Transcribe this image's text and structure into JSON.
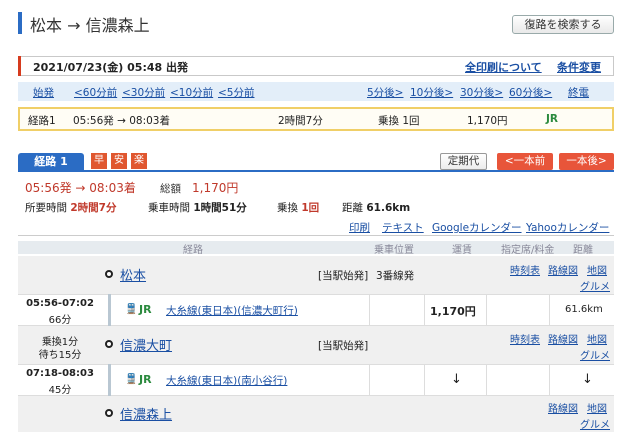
{
  "header": {
    "title": "松本 → 信濃森上",
    "search_button": "復路を検索する"
  },
  "date_bar": {
    "text": "2021/07/23(金) 05:48 出発",
    "print_all": "全印刷について",
    "change_cond": "条件変更"
  },
  "time_nav": {
    "first": "始発",
    "b60": "<60分前",
    "b30": "<30分前",
    "b10": "<10分前",
    "b5": "<5分前",
    "a5": "5分後>",
    "a10": "10分後>",
    "a30": "30分後>",
    "a60": "60分後>",
    "last": "終電"
  },
  "summary": {
    "route": "経路1",
    "times": "05:56発 → 08:03着",
    "duration": "2時間7分",
    "transfer": "乗換 1回",
    "fare": "1,170円",
    "operator": "JR"
  },
  "tabs": {
    "route": "経路 1",
    "badges": [
      "早",
      "安",
      "楽"
    ],
    "teiki": "定期代",
    "prev": "<一本前",
    "next": "一本後>"
  },
  "detail": {
    "time": "05:56発 → 08:03着",
    "total_label": "総額",
    "total_value": "1,170円",
    "req_label": "所要時間",
    "req_value": "2時間7分",
    "ride_label": "乗車時間",
    "ride_value": "1時間51分",
    "transfer_label": "乗換",
    "transfer_value": "1回",
    "distance_label": "距離",
    "distance_value": "61.6km",
    "tools": [
      "印刷",
      "テキスト",
      "Googleカレンダー",
      "Yahooカレンダー"
    ]
  },
  "table": {
    "headers": [
      "経路",
      "乗車位置",
      "運賃",
      "指定席/料金",
      "距離"
    ],
    "stations": [
      {
        "name": "松本",
        "note": "[当駅始発]",
        "platform": "3番線発",
        "links": [
          "時刻表",
          "路線図",
          "地図",
          "グルメ"
        ]
      },
      {
        "name": "信濃大町",
        "note": "[当駅始発]",
        "links": [
          "時刻表",
          "路線図",
          "地図",
          "グルメ"
        ]
      },
      {
        "name": "信濃森上",
        "links": [
          "路線図",
          "地図",
          "グルメ"
        ]
      }
    ],
    "legs": [
      {
        "time": "05:56-07:02",
        "duration": "66分",
        "icon": "train-icon",
        "company": "JR",
        "line": "大糸線(東日本)(信濃大町行)",
        "fare": "1,170円",
        "distance": "61.6km"
      },
      {
        "time": "07:18-08:03",
        "duration": "45分",
        "icon": "train-icon",
        "company": "JR",
        "line": "大糸線(東日本)(南小谷行)",
        "fare": "↓",
        "distance": "↓"
      }
    ],
    "transfer": {
      "line1": "乗換1分",
      "line2": "待ち15分"
    }
  }
}
